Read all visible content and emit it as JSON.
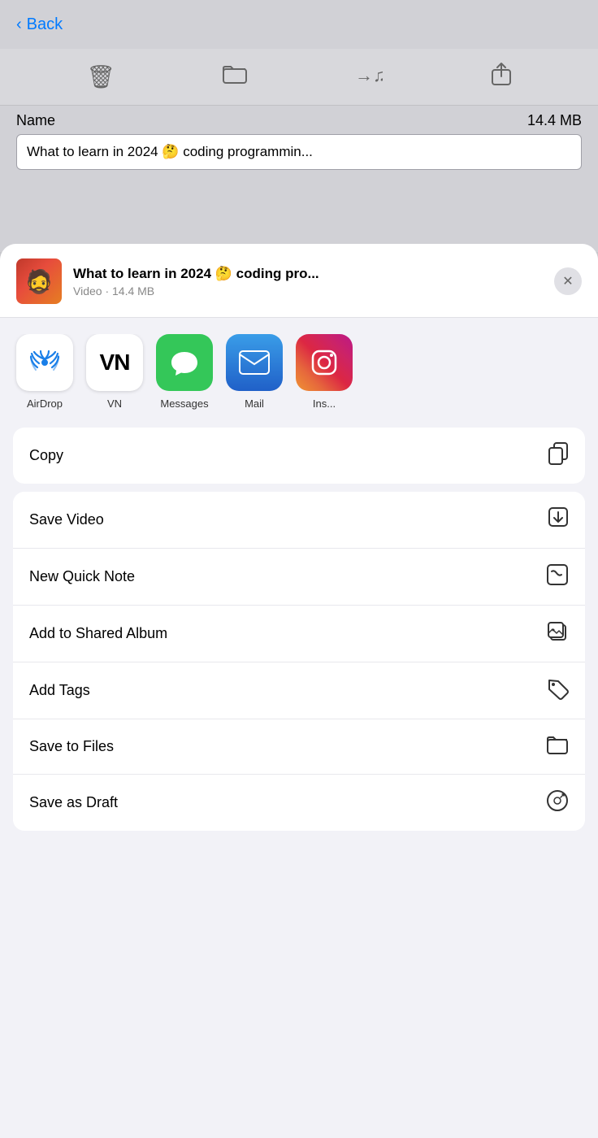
{
  "background": {
    "back_label": "Back",
    "name_label": "Name",
    "size_label": "14.4 MB",
    "filename": "What to learn in 2024 🤔 coding programmin..."
  },
  "share_header": {
    "title": "What to learn in 2024 🤔 coding pro...",
    "subtitle": "Video · 14.4 MB",
    "close_label": "×"
  },
  "apps": [
    {
      "id": "airdrop",
      "label": "AirDrop"
    },
    {
      "id": "vn",
      "label": "VN"
    },
    {
      "id": "messages",
      "label": "Messages"
    },
    {
      "id": "mail",
      "label": "Mail"
    },
    {
      "id": "instagram",
      "label": "Ins..."
    }
  ],
  "actions": [
    {
      "id": "copy",
      "label": "Copy"
    },
    {
      "id": "save-video",
      "label": "Save Video"
    },
    {
      "id": "new-quick-note",
      "label": "New Quick Note"
    },
    {
      "id": "add-shared-album",
      "label": "Add to Shared Album"
    },
    {
      "id": "add-tags",
      "label": "Add Tags"
    },
    {
      "id": "save-to-files",
      "label": "Save to Files"
    },
    {
      "id": "save-as-draft",
      "label": "Save as Draft"
    }
  ]
}
